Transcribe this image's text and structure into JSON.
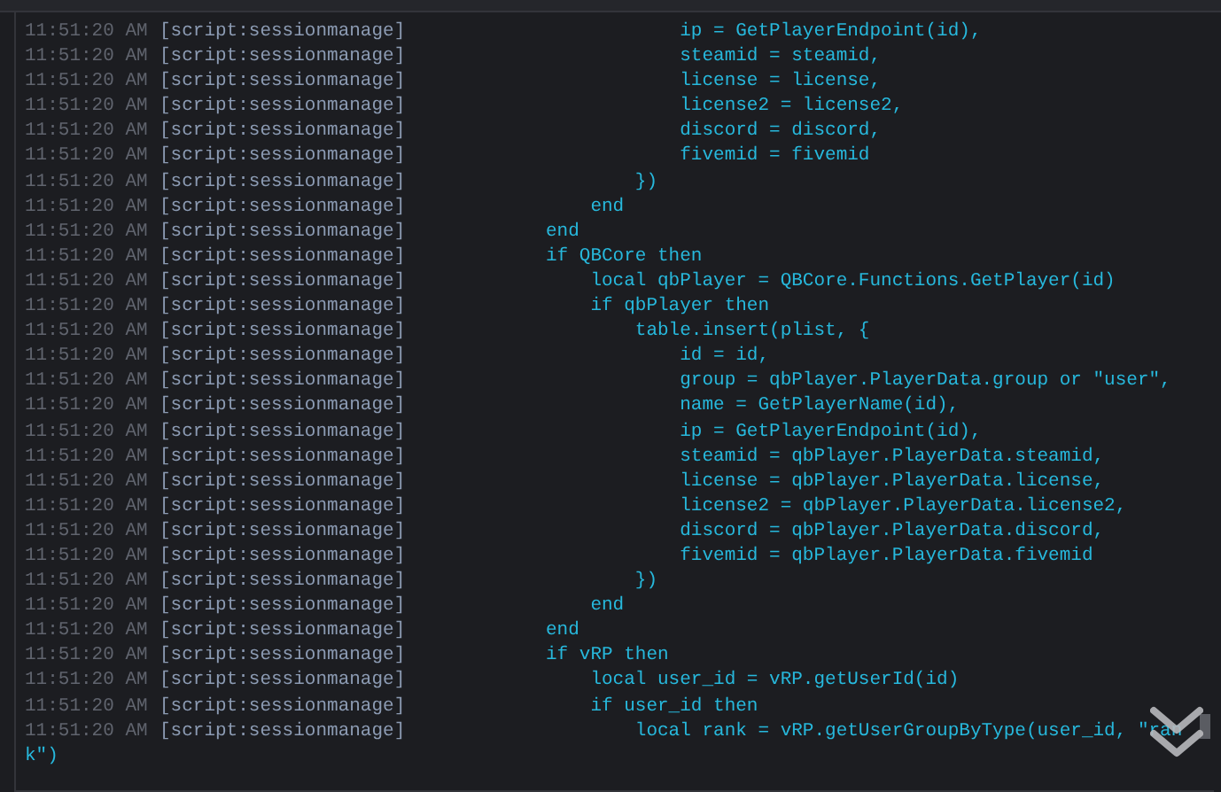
{
  "log_lines": [
    {
      "time": "11:51:20 AM",
      "source": "[script:sessionmanage]",
      "message": "            ip = GetPlayerEndpoint(id),"
    },
    {
      "time": "11:51:20 AM",
      "source": "[script:sessionmanage]",
      "message": "            steamid = steamid,"
    },
    {
      "time": "11:51:20 AM",
      "source": "[script:sessionmanage]",
      "message": "            license = license,"
    },
    {
      "time": "11:51:20 AM",
      "source": "[script:sessionmanage]",
      "message": "            license2 = license2,"
    },
    {
      "time": "11:51:20 AM",
      "source": "[script:sessionmanage]",
      "message": "            discord = discord,"
    },
    {
      "time": "11:51:20 AM",
      "source": "[script:sessionmanage]",
      "message": "            fivemid = fivemid"
    },
    {
      "time": "11:51:20 AM",
      "source": "[script:sessionmanage]",
      "message": "        })"
    },
    {
      "time": "11:51:20 AM",
      "source": "[script:sessionmanage]",
      "message": "    end"
    },
    {
      "time": "11:51:20 AM",
      "source": "[script:sessionmanage]",
      "message": "end"
    },
    {
      "time": "11:51:20 AM",
      "source": "[script:sessionmanage]",
      "message": "if QBCore then"
    },
    {
      "time": "11:51:20 AM",
      "source": "[script:sessionmanage]",
      "message": "    local qbPlayer = QBCore.Functions.GetPlayer(id)"
    },
    {
      "time": "11:51:20 AM",
      "source": "[script:sessionmanage]",
      "message": "    if qbPlayer then"
    },
    {
      "time": "11:51:20 AM",
      "source": "[script:sessionmanage]",
      "message": "        table.insert(plist, {"
    },
    {
      "time": "11:51:20 AM",
      "source": "[script:sessionmanage]",
      "message": "            id = id,"
    },
    {
      "time": "11:51:20 AM",
      "source": "[script:sessionmanage]",
      "message": "            group = qbPlayer.PlayerData.group or \"user\","
    },
    {
      "time": "11:51:20 AM",
      "source": "[script:sessionmanage]",
      "message": "            name = GetPlayerName(id),"
    },
    {
      "time": "11:51:20 AM",
      "source": "[script:sessionmanage]",
      "message": "            ip = GetPlayerEndpoint(id),"
    },
    {
      "time": "11:51:20 AM",
      "source": "[script:sessionmanage]",
      "message": "            steamid = qbPlayer.PlayerData.steamid,"
    },
    {
      "time": "11:51:20 AM",
      "source": "[script:sessionmanage]",
      "message": "            license = qbPlayer.PlayerData.license,"
    },
    {
      "time": "11:51:20 AM",
      "source": "[script:sessionmanage]",
      "message": "            license2 = qbPlayer.PlayerData.license2,"
    },
    {
      "time": "11:51:20 AM",
      "source": "[script:sessionmanage]",
      "message": "            discord = qbPlayer.PlayerData.discord,"
    },
    {
      "time": "11:51:20 AM",
      "source": "[script:sessionmanage]",
      "message": "            fivemid = qbPlayer.PlayerData.fivemid"
    },
    {
      "time": "11:51:20 AM",
      "source": "[script:sessionmanage]",
      "message": "        })"
    },
    {
      "time": "11:51:20 AM",
      "source": "[script:sessionmanage]",
      "message": "    end"
    },
    {
      "time": "11:51:20 AM",
      "source": "[script:sessionmanage]",
      "message": "end"
    },
    {
      "time": "11:51:20 AM",
      "source": "[script:sessionmanage]",
      "message": "if vRP then"
    },
    {
      "time": "11:51:20 AM",
      "source": "[script:sessionmanage]",
      "message": "    local user_id = vRP.getUserId(id)"
    },
    {
      "time": "11:51:20 AM",
      "source": "[script:sessionmanage]",
      "message": "    if user_id then"
    },
    {
      "time": "11:51:20 AM",
      "source": "[script:sessionmanage]",
      "message": "        local rank = vRP.getUserGroupByType(user_id, \"ran"
    }
  ],
  "continuation": "k\")"
}
